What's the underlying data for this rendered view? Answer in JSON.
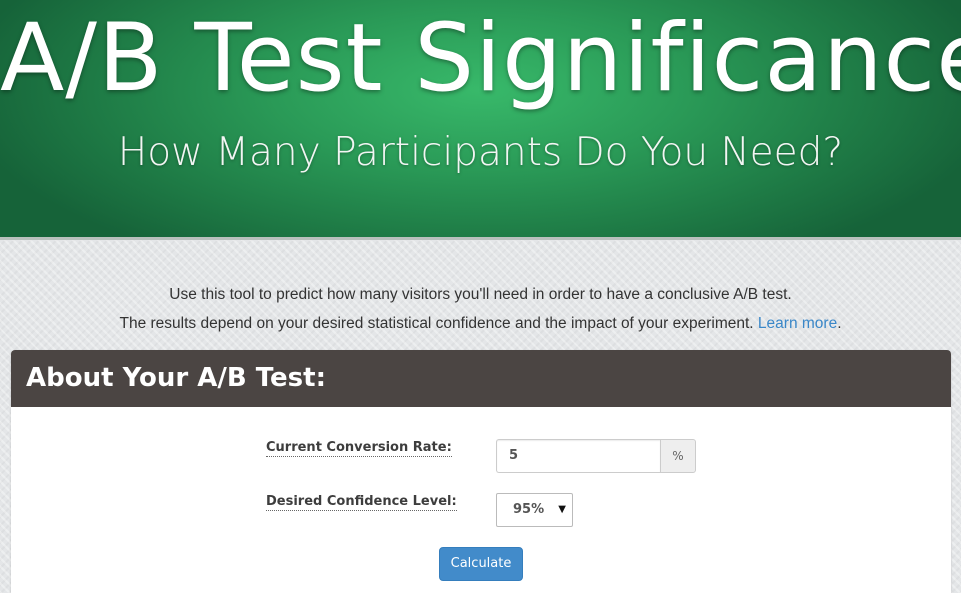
{
  "hero": {
    "title": "A/B Test Significance",
    "subtitle": "How Many Participants Do You Need?"
  },
  "intro": {
    "line1": "Use this tool to predict how many visitors you'll need in order to have a conclusive A/B test.",
    "line2": "The results depend on your desired statistical confidence and the impact of your experiment. ",
    "learn_more": "Learn more",
    "line2_end": "."
  },
  "panel": {
    "heading": "About Your A/B Test:",
    "conversion_label": "Current Conversion Rate:",
    "conversion_value": "5",
    "conversion_unit": "%",
    "confidence_label": "Desired Confidence Level:",
    "confidence_value": "95%",
    "calculate_label": "Calculate"
  },
  "colors": {
    "hero_green": "#2a9a57",
    "panel_header": "#4b4543",
    "button_blue": "#428bca",
    "link_blue": "#3a87c8"
  },
  "icons": {
    "select_arrow": "chevron-down-icon"
  }
}
